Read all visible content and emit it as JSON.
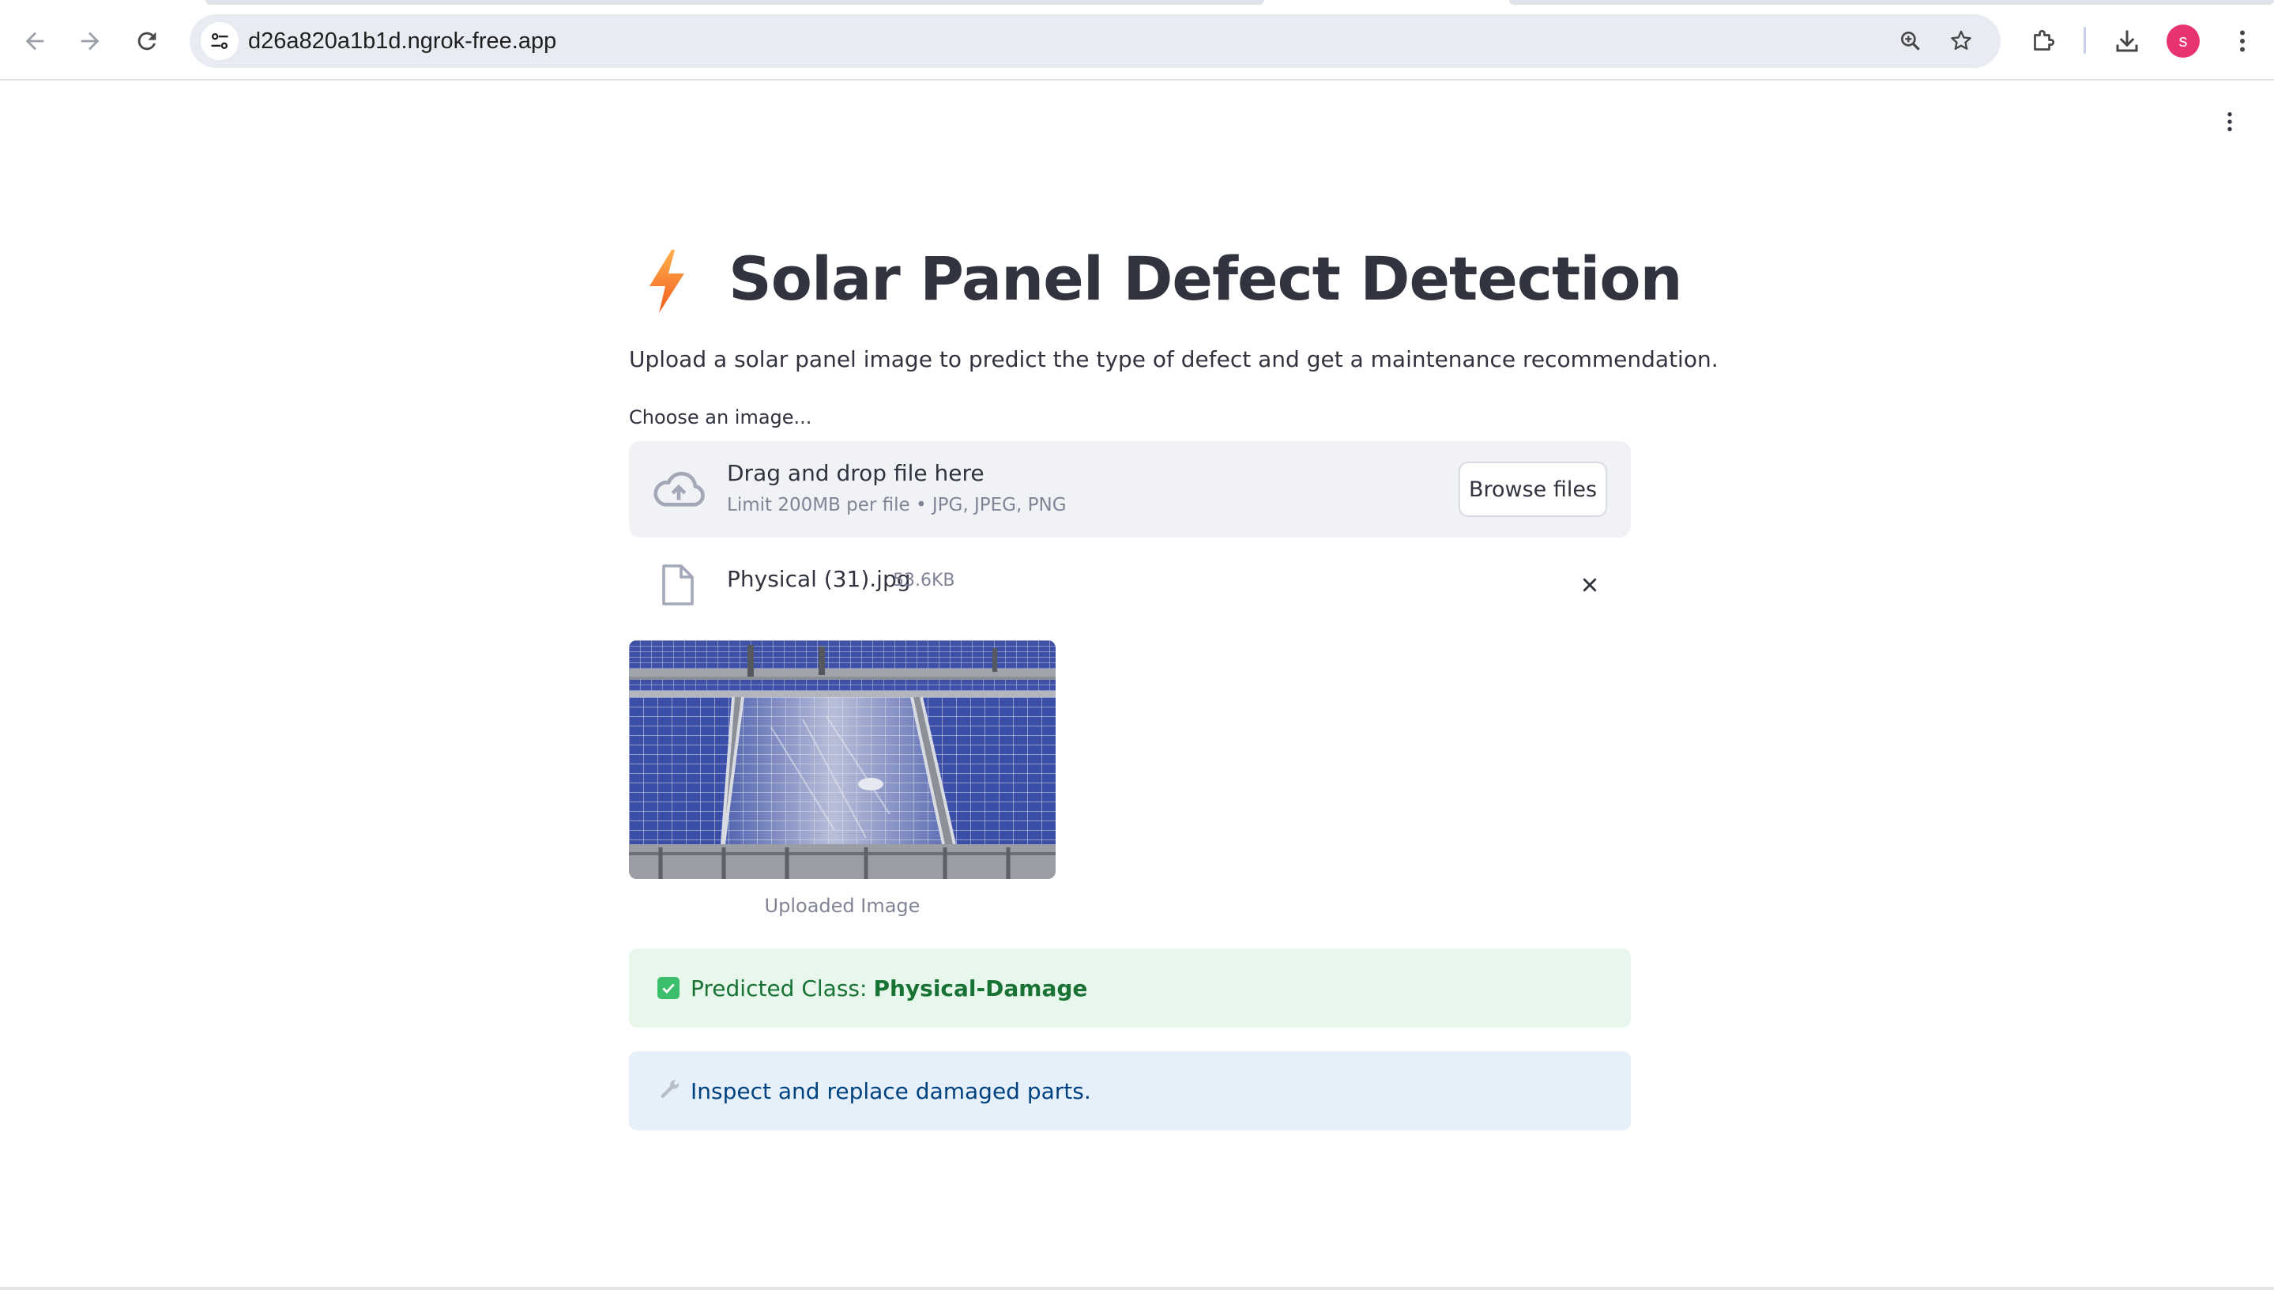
{
  "browser": {
    "url": "d26a820a1b1d.ngrok-free.app",
    "profile_initial": "s",
    "icons": [
      "back-icon",
      "forward-icon",
      "reload-icon",
      "site-info-icon",
      "zoom-icon",
      "bookmark-star-icon",
      "extensions-icon",
      "download-icon",
      "menu-kebab-icon"
    ]
  },
  "app": {
    "title_icon": "lightning-bolt-icon",
    "title": "Solar Panel Defect Detection",
    "subtitle": "Upload a solar panel image to predict the type of defect and get a maintenance recommendation.",
    "uploader": {
      "label": "Choose an image...",
      "drag_text": "Drag and drop file here",
      "limit_text": "Limit 200MB per file • JPG, JPEG, PNG",
      "browse_label": "Browse files"
    },
    "uploaded_file": {
      "name": "Physical (31).jpg",
      "size": "53.6KB"
    },
    "image_caption": "Uploaded Image",
    "prediction": {
      "label": "Predicted Class:",
      "value": "Physical-Damage"
    },
    "recommendation": "Inspect and replace damaged parts.",
    "colors": {
      "success_bg": "#e7f7ec",
      "success_text": "#177233",
      "info_bg": "#e5f0fb",
      "info_text": "#004280",
      "accent": "#ff4b4b"
    }
  }
}
